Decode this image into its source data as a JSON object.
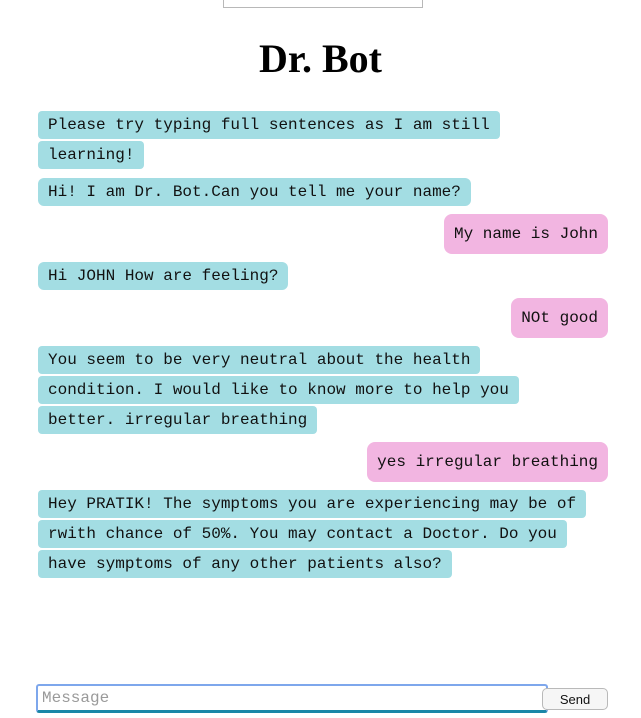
{
  "header": {
    "title": "Dr. Bot"
  },
  "messages": [
    {
      "sender": "bot",
      "text": "Please try typing full sentences as I am still learning!"
    },
    {
      "sender": "bot",
      "text": "Hi! I am Dr. Bot.Can you tell me your name?"
    },
    {
      "sender": "user",
      "text": "My name is John"
    },
    {
      "sender": "bot",
      "text": "Hi JOHN How are feeling?"
    },
    {
      "sender": "user",
      "text": "NOt good"
    },
    {
      "sender": "bot",
      "text": "You seem to be very neutral about the health condition. I would like to know more to help you better. irregular breathing"
    },
    {
      "sender": "user",
      "text": "yes irregular breathing"
    },
    {
      "sender": "bot",
      "text": "Hey PRATIK! The symptoms you are experiencing may be of rwith chance of 50%. You may contact a Doctor. Do you have symptoms of any other patients also?"
    }
  ],
  "composer": {
    "placeholder": "Message",
    "value": "",
    "send_label": "Send"
  },
  "colors": {
    "bot_bubble": "#a3dde3",
    "user_bubble": "#f2b5e1",
    "input_focus": "#7ea7ec"
  }
}
